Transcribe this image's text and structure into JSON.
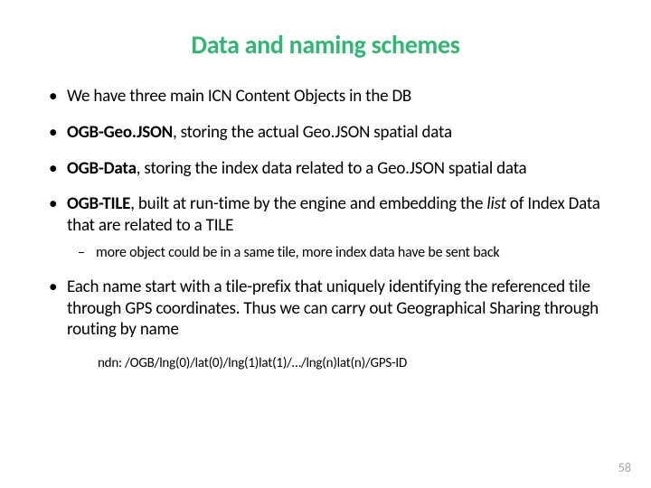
{
  "title": "Data and naming schemes",
  "bullets": {
    "b1": "We have three main ICN Content Objects in the DB",
    "b2_bold": "OGB-Geo.JSON",
    "b2_rest": ", storing the actual Geo.JSON spatial data",
    "b3_bold": "OGB-Data",
    "b3_rest": ", storing the index data related to a Geo.JSON spatial data",
    "b4_bold": "OGB-TILE",
    "b4_rest1": ", built at run-time by the engine and embedding the ",
    "b4_ital": "list",
    "b4_rest2": " of Index Data that are related to a TILE",
    "b4_sub": "more object could be in a same tile, more index data  have be sent back",
    "b5": "Each name start with a tile-prefix that uniquely identifying the referenced tile through GPS coordinates. Thus we can carry out Geographical Sharing through routing by name"
  },
  "ndn_line": "ndn: /OGB/lng(0)/lat(0)/lng(1)lat(1)/…/lng(n)lat(n)/GPS-ID",
  "page_number": "58"
}
